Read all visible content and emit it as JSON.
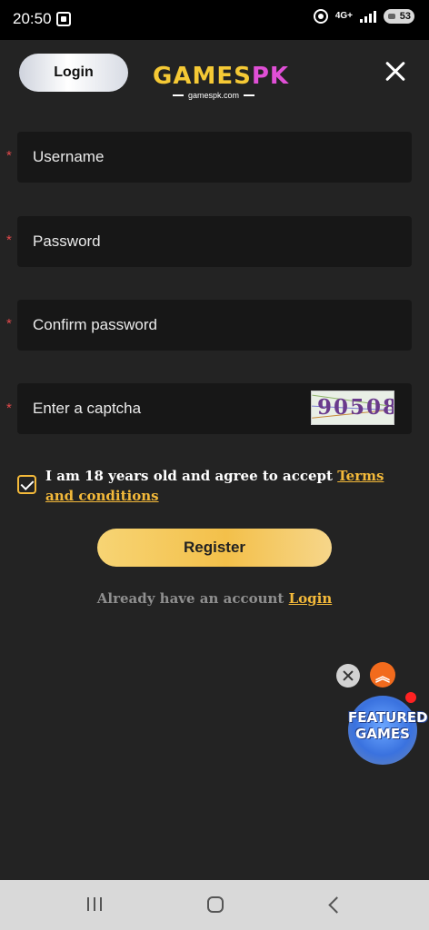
{
  "status_bar": {
    "time": "20:50",
    "network": "4G+",
    "battery": "53"
  },
  "header": {
    "login_tab": "Login",
    "logo_main_1": "GAMES",
    "logo_main_2": "PK",
    "logo_sub": "gamespk.com"
  },
  "form": {
    "username_placeholder": "Username",
    "password_placeholder": "Password",
    "confirm_password_placeholder": "Confirm password",
    "captcha_placeholder": "Enter a captcha",
    "captcha_code": "90508",
    "required_mark": "*",
    "agree_text": "I am 18 years old and agree to accept ",
    "terms_link": "Terms and conditions",
    "agree_checked": true,
    "register_label": "Register",
    "already_text": "Already have an account ",
    "login_link": "Login"
  },
  "floating": {
    "featured_label_1": "FEATURED",
    "featured_label_2": "GAMES"
  },
  "colors": {
    "background": "#232323",
    "field": "#171717",
    "accent_gold": "#f3b93a",
    "required": "#e0484a"
  }
}
